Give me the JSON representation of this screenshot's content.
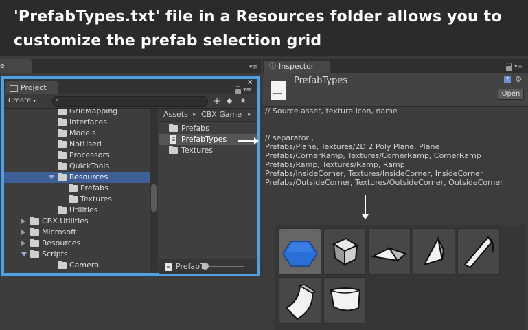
{
  "banner": {
    "line1": "'PrefabTypes.txt' file in a Resources folder allows you to",
    "line2": "customize the prefab selection grid"
  },
  "behind_tab": {
    "label": "e"
  },
  "project": {
    "tab_label": "Project",
    "create_label": "Create",
    "tree": [
      {
        "label": "GridMapping",
        "depth": 2,
        "expanded": null,
        "selected": false
      },
      {
        "label": "Interfaces",
        "depth": 2,
        "expanded": null,
        "selected": false
      },
      {
        "label": "Models",
        "depth": 2,
        "expanded": null,
        "selected": false
      },
      {
        "label": "NotUsed",
        "depth": 2,
        "expanded": null,
        "selected": false
      },
      {
        "label": "Processors",
        "depth": 2,
        "expanded": null,
        "selected": false
      },
      {
        "label": "QuickTools",
        "depth": 2,
        "expanded": null,
        "selected": false
      },
      {
        "label": "Resources",
        "depth": 2,
        "expanded": true,
        "selected": true
      },
      {
        "label": "Prefabs",
        "depth": 3,
        "expanded": null,
        "selected": false
      },
      {
        "label": "Textures",
        "depth": 3,
        "expanded": null,
        "selected": false
      },
      {
        "label": "Utilities",
        "depth": 2,
        "expanded": null,
        "selected": false
      },
      {
        "label": "CBX.Utilities",
        "depth": 1,
        "expanded": false,
        "selected": false
      },
      {
        "label": "Microsoft",
        "depth": 1,
        "expanded": false,
        "selected": false
      },
      {
        "label": "Resources",
        "depth": 1,
        "expanded": false,
        "selected": false
      },
      {
        "label": "Scripts",
        "depth": 1,
        "expanded": true,
        "selected": false
      },
      {
        "label": "Camera",
        "depth": 2,
        "expanded": null,
        "selected": false
      }
    ],
    "breadcrumb": [
      "Assets",
      "CBX Game"
    ],
    "assets": [
      {
        "label": "Prefabs",
        "type": "folder",
        "selected": false
      },
      {
        "label": "PrefabTypes",
        "type": "text-file",
        "selected": true
      },
      {
        "label": "Textures",
        "type": "folder",
        "selected": false
      }
    ],
    "bottom_file": "PrefabTy"
  },
  "inspector": {
    "tab_label": "Inspector",
    "title": "PrefabTypes",
    "open_label": "Open",
    "file_text": "// Source asset, texture icon, name\n\n\n// separator ,\nPrefabs/Plane, Textures/2D 2 Poly Plane, Plane\nPrefabs/CornerRamp, Textures/CornerRamp, CornerRamp\nPrefabs/Ramp, Textures/Ramp, Ramp\nPrefabs/InsideCorner, Textures/InsideCorner, InsideCorner\nPrefabs/OutsideCorner, Textures/OutsideCorner, OutsideCorner"
  },
  "prefab_grid": [
    {
      "name": "plane",
      "selected": true
    },
    {
      "name": "cube",
      "selected": false
    },
    {
      "name": "corner-ramp",
      "selected": false
    },
    {
      "name": "ramp",
      "selected": false
    },
    {
      "name": "inside-corner",
      "selected": false
    },
    {
      "name": "outside-corner-curved",
      "selected": false
    },
    {
      "name": "rounded-box",
      "selected": false
    }
  ],
  "colors": {
    "highlight_frame": "#4ea1e4",
    "selection": "#3e5f96",
    "plane_blue": "#2a6fd8"
  }
}
